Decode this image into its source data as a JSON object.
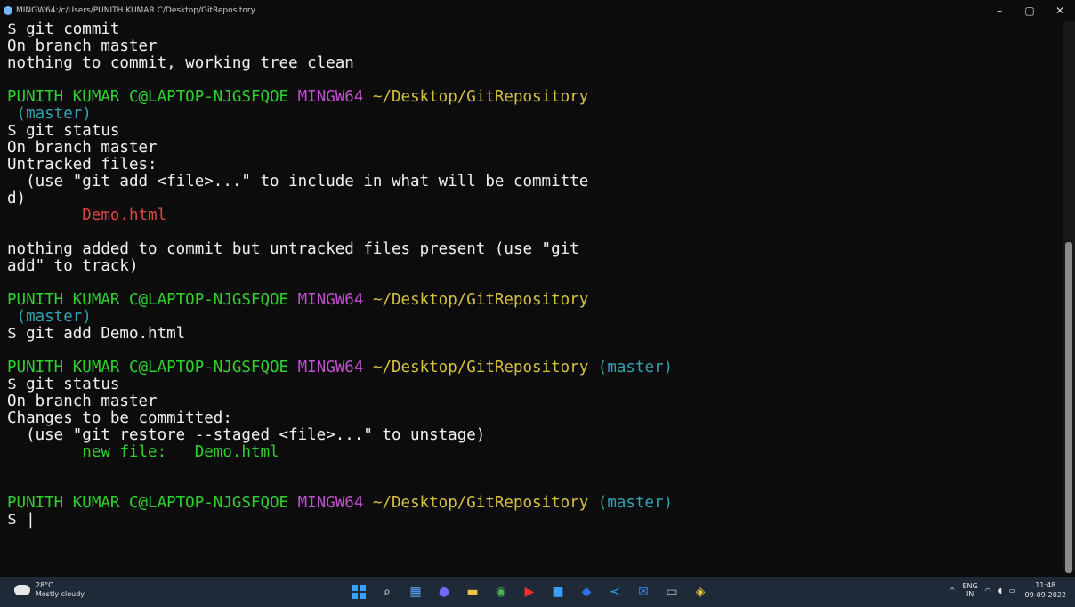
{
  "window": {
    "title": "MINGW64:/c/Users/PUNITH KUMAR C/Desktop/GitRepository",
    "controls": {
      "minimize": "–",
      "maximize": "▢",
      "close": "✕"
    }
  },
  "terminal": {
    "lines": [
      [
        {
          "t": "$ git commit",
          "c": ""
        }
      ],
      [
        {
          "t": "On branch master",
          "c": ""
        }
      ],
      [
        {
          "t": "nothing to commit, working tree clean",
          "c": ""
        }
      ],
      [
        {
          "t": "",
          "c": ""
        }
      ],
      [
        {
          "t": "PUNITH KUMAR C@LAPTOP-NJGSFQOE ",
          "c": "green"
        },
        {
          "t": "MINGW64 ",
          "c": "purple"
        },
        {
          "t": "~/Desktop/GitRepository",
          "c": "yellow"
        }
      ],
      [
        {
          "t": " (master)",
          "c": "cyan"
        }
      ],
      [
        {
          "t": "$ git status",
          "c": ""
        }
      ],
      [
        {
          "t": "On branch master",
          "c": ""
        }
      ],
      [
        {
          "t": "Untracked files:",
          "c": ""
        }
      ],
      [
        {
          "t": "  (use \"git add <file>...\" to include in what will be committe",
          "c": ""
        }
      ],
      [
        {
          "t": "d)",
          "c": ""
        }
      ],
      [
        {
          "t": "        ",
          "c": ""
        },
        {
          "t": "Demo.html",
          "c": "red"
        }
      ],
      [
        {
          "t": "",
          "c": ""
        }
      ],
      [
        {
          "t": "nothing added to commit but untracked files present (use \"git",
          "c": ""
        }
      ],
      [
        {
          "t": "add\" to track)",
          "c": ""
        }
      ],
      [
        {
          "t": "",
          "c": ""
        }
      ],
      [
        {
          "t": "PUNITH KUMAR C@LAPTOP-NJGSFQOE ",
          "c": "green"
        },
        {
          "t": "MINGW64 ",
          "c": "purple"
        },
        {
          "t": "~/Desktop/GitRepository",
          "c": "yellow"
        }
      ],
      [
        {
          "t": " (master)",
          "c": "cyan"
        }
      ],
      [
        {
          "t": "$ git add Demo.html",
          "c": ""
        }
      ],
      [
        {
          "t": "",
          "c": ""
        }
      ],
      [
        {
          "t": "PUNITH KUMAR C@LAPTOP-NJGSFQOE ",
          "c": "green"
        },
        {
          "t": "MINGW64 ",
          "c": "purple"
        },
        {
          "t": "~/Desktop/GitRepository ",
          "c": "yellow"
        },
        {
          "t": "(master)",
          "c": "cyan"
        }
      ],
      [
        {
          "t": "$ git status",
          "c": ""
        }
      ],
      [
        {
          "t": "On branch master",
          "c": ""
        }
      ],
      [
        {
          "t": "Changes to be committed:",
          "c": ""
        }
      ],
      [
        {
          "t": "  (use \"git restore --staged <file>...\" to unstage)",
          "c": ""
        }
      ],
      [
        {
          "t": "        ",
          "c": ""
        },
        {
          "t": "new file:   Demo.html",
          "c": "green"
        }
      ],
      [
        {
          "t": "",
          "c": ""
        }
      ],
      [
        {
          "t": "",
          "c": ""
        }
      ],
      [
        {
          "t": "PUNITH KUMAR C@LAPTOP-NJGSFQOE ",
          "c": "green"
        },
        {
          "t": "MINGW64 ",
          "c": "purple"
        },
        {
          "t": "~/Desktop/GitRepository ",
          "c": "yellow"
        },
        {
          "t": "(master)",
          "c": "cyan"
        }
      ],
      [
        {
          "t": "$ ",
          "c": ""
        },
        {
          "t": "|",
          "c": "cursor"
        }
      ]
    ]
  },
  "taskbar": {
    "weather": {
      "temp": "28°C",
      "condition": "Mostly cloudy"
    },
    "apps": [
      {
        "name": "start-button",
        "glyph": "win"
      },
      {
        "name": "search-icon",
        "glyph": "⌕",
        "color": "#ffffff"
      },
      {
        "name": "widgets-icon",
        "glyph": "▦",
        "color": "#5aa7ff"
      },
      {
        "name": "chat-icon",
        "glyph": "●",
        "color": "#6b6bff"
      },
      {
        "name": "file-explorer-icon",
        "glyph": "▬",
        "color": "#f2c34a"
      },
      {
        "name": "chrome-icon",
        "glyph": "◉",
        "color": "#4caf50"
      },
      {
        "name": "youtube-icon",
        "glyph": "▶",
        "color": "#ff2b2b"
      },
      {
        "name": "store-icon",
        "glyph": "■",
        "color": "#3aa0ff"
      },
      {
        "name": "edge-icon",
        "glyph": "◆",
        "color": "#2d6ee0"
      },
      {
        "name": "vscode-icon",
        "glyph": "≺",
        "color": "#2a9df4"
      },
      {
        "name": "mail-icon",
        "glyph": "✉",
        "color": "#2f8ef0"
      },
      {
        "name": "terminal-icon",
        "glyph": "▭",
        "color": "#bdbdbd"
      },
      {
        "name": "git-icon",
        "glyph": "◈",
        "color": "#e8c23a"
      }
    ],
    "tray": {
      "chevron": "^",
      "language": "ENG",
      "region": "IN",
      "time": "11:48",
      "date": "09-09-2022"
    }
  }
}
